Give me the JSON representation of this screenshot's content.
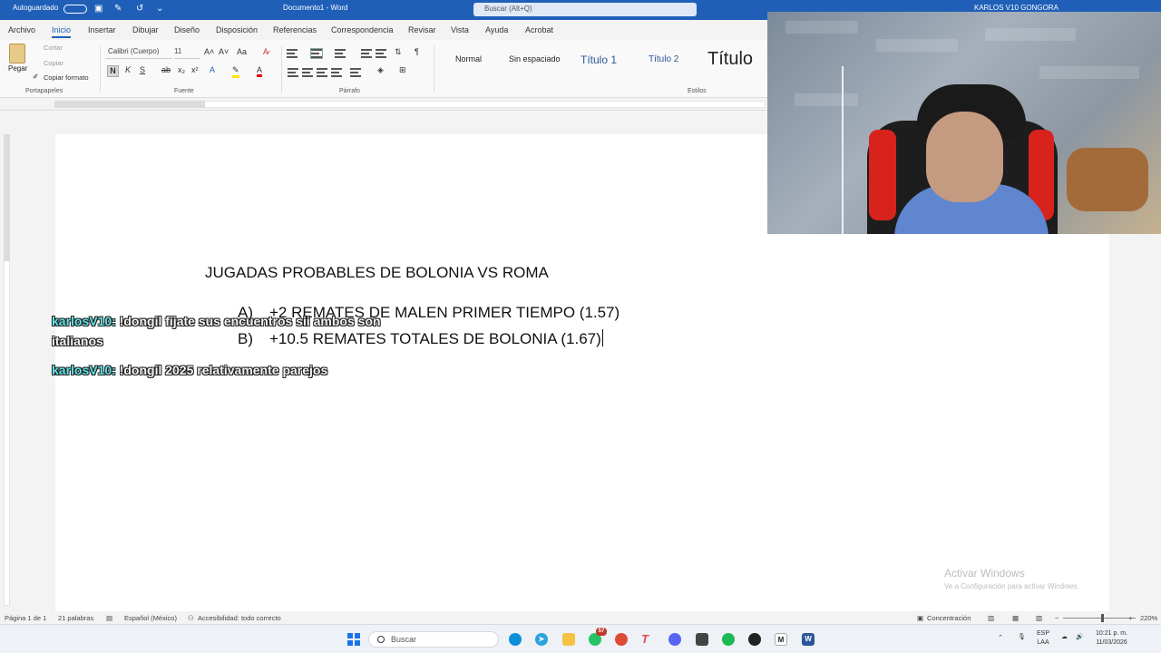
{
  "titlebar": {
    "autosave": "Autoguardado",
    "doc_title": "Documento1 - Word",
    "search": "Buscar (Alt+Q)",
    "user": "KARLOS V10 GONGORA"
  },
  "tabs": [
    "Archivo",
    "Inicio",
    "Insertar",
    "Dibujar",
    "Diseño",
    "Disposición",
    "Referencias",
    "Correspondencia",
    "Revisar",
    "Vista",
    "Ayuda",
    "Acrobat"
  ],
  "ribbon": {
    "clipboard": {
      "paste": "Pegar",
      "cut": "Cortar",
      "copy": "Copiar",
      "format_painter": "Copiar formato",
      "group": "Portapapeles"
    },
    "font": {
      "name": "Calibri (Cuerpo)",
      "size": "11",
      "group": "Fuente"
    },
    "paragraph": {
      "group": "Párrafo"
    },
    "styles": {
      "items": [
        "Normal",
        "Sin espaciado",
        "Título 1",
        "Título 2",
        "Título"
      ],
      "group": "Estilos"
    }
  },
  "document": {
    "title": "JUGADAS PROBABLES DE BOLONIA VS ROMA",
    "items": [
      {
        "marker": "A)",
        "text": "+2 REMATES DE MALEN PRIMER TIEMPO (1.57)"
      },
      {
        "marker": "B)",
        "text": "+10.5 REMATES TOTALES DE BOLONIA (1.67)"
      }
    ]
  },
  "chat": [
    {
      "user": "karlosV10:",
      "message": "!dongil fijate sus encuentros sii ambos son",
      "message_cont": "italianos"
    },
    {
      "user": "karlosV10:",
      "message": "!dongil 2025 relativamente parejos"
    }
  ],
  "watermark": {
    "line1": "Activar Windows",
    "line2": "Ve a Configuración para activar Windows."
  },
  "statusbar": {
    "page": "Página 1 de 1",
    "words": "21 palabras",
    "language": "Español (México)",
    "accessibility": "Accesibilidad: todo correcto",
    "focus": "Concentración",
    "zoom": "220%"
  },
  "taskbar": {
    "search_placeholder": "Buscar",
    "notification_badge": "57",
    "lang_top": "ESP",
    "lang_bottom": "LAA",
    "time": "10:21 p. m.",
    "date": "11/03/2026"
  }
}
